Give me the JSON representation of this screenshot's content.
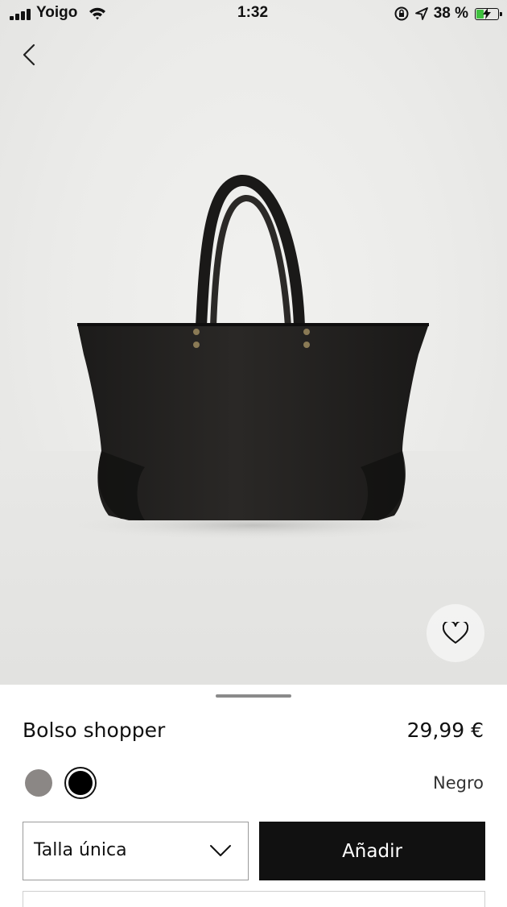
{
  "status_bar": {
    "carrier": "Yoigo",
    "time": "1:32",
    "battery_percent": "38 %",
    "battery_level": 0.38,
    "battery_color": "#3fc13f",
    "icons": [
      "signal-icon",
      "wifi-icon",
      "orientation-lock-icon",
      "location-arrow-icon",
      "battery-charging-icon"
    ]
  },
  "nav": {
    "back_icon": "chevron-left-icon"
  },
  "product": {
    "image_alt": "black-tote-bag",
    "favorite_icon": "heart-outline-icon",
    "name": "Bolso shopper",
    "price": "29,99 €",
    "colors": [
      {
        "hex": "#8b8785",
        "selected": false
      },
      {
        "hex": "#000000",
        "selected": true
      }
    ],
    "selected_color_name": "Negro",
    "size": {
      "value": "Talla única",
      "icon": "chevron-down-icon"
    },
    "add_button_label": "Añadir"
  }
}
